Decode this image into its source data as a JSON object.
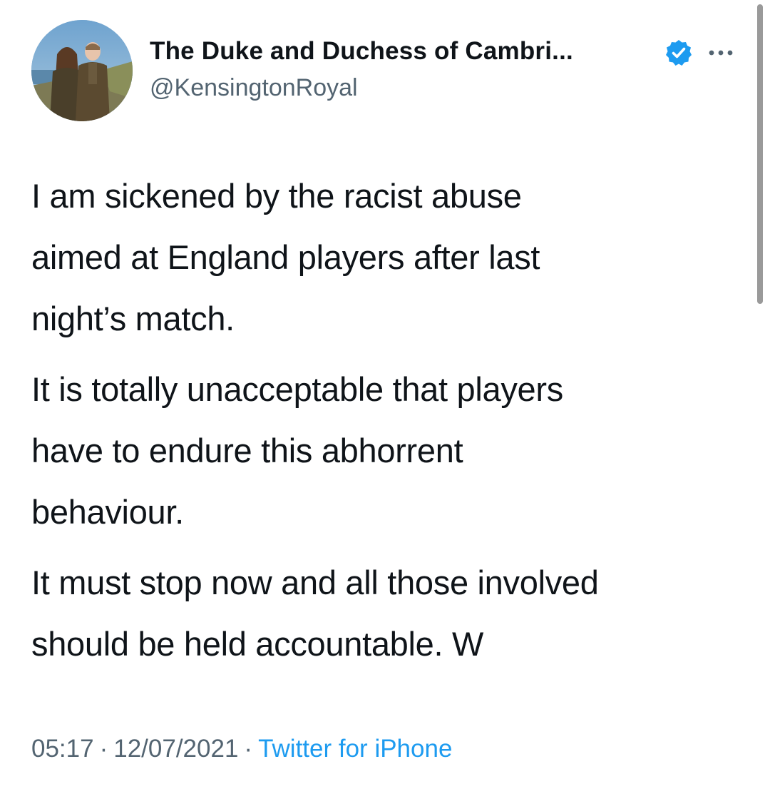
{
  "author": {
    "name": "The Duke and Duchess of Cambri...",
    "handle": "@KensingtonRoyal",
    "avatar_icon": "profile-photo-avatar",
    "verified_icon": "verified-badge-icon",
    "more_icon": "more-options-icon"
  },
  "tweet": {
    "paragraphs": [
      "I am sickened by the racist abuse\naimed at England players after last\nnight’s match.",
      "It is totally unacceptable that players\nhave to endure this abhorrent\nbehaviour.",
      "It must stop now and all those involved\nshould be held accountable. W"
    ]
  },
  "meta": {
    "time": "05:17",
    "separator": "·",
    "date": "12/07/2021",
    "source": "Twitter for iPhone"
  },
  "colors": {
    "text": "#0f1419",
    "secondary": "#536471",
    "accent": "#1d9bf0",
    "background": "#ffffff"
  }
}
